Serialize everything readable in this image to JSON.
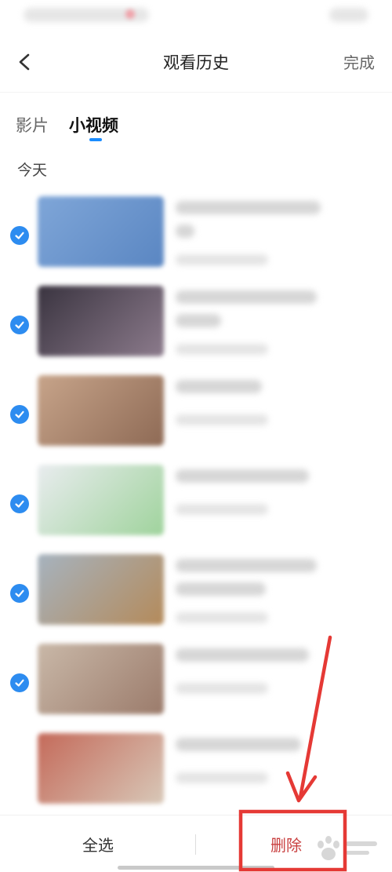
{
  "header": {
    "title": "观看历史",
    "done_label": "完成"
  },
  "tabs": [
    {
      "label": "影片",
      "active": false
    },
    {
      "label": "小视频",
      "active": true
    }
  ],
  "section": {
    "label": "今天"
  },
  "items": [
    {
      "checked": true,
      "thumb_colors": [
        "#7fa6d8",
        "#5a86c2"
      ]
    },
    {
      "checked": true,
      "thumb_colors": [
        "#3a3440",
        "#8c7b8c"
      ]
    },
    {
      "checked": true,
      "thumb_colors": [
        "#c7a48a",
        "#8e6a55"
      ]
    },
    {
      "checked": true,
      "thumb_colors": [
        "#e9ecef",
        "#9fd39c"
      ]
    },
    {
      "checked": true,
      "thumb_colors": [
        "#a6b3bf",
        "#b48a5a"
      ]
    },
    {
      "checked": true,
      "thumb_colors": [
        "#c9b8a8",
        "#9b7b6b"
      ]
    },
    {
      "checked": false,
      "thumb_colors": [
        "#c46a5a",
        "#d8c8b8"
      ]
    }
  ],
  "footer": {
    "select_all_label": "全选",
    "delete_label": "删除"
  },
  "colors": {
    "accent": "#2d8cf0",
    "delete": "#c94040",
    "annotation": "#e53935"
  },
  "icons": {
    "back": "chevron-left-icon",
    "check": "check-circle-icon",
    "arrow": "red-arrow-annotation",
    "watermark": "baidu-jingyan-watermark"
  }
}
